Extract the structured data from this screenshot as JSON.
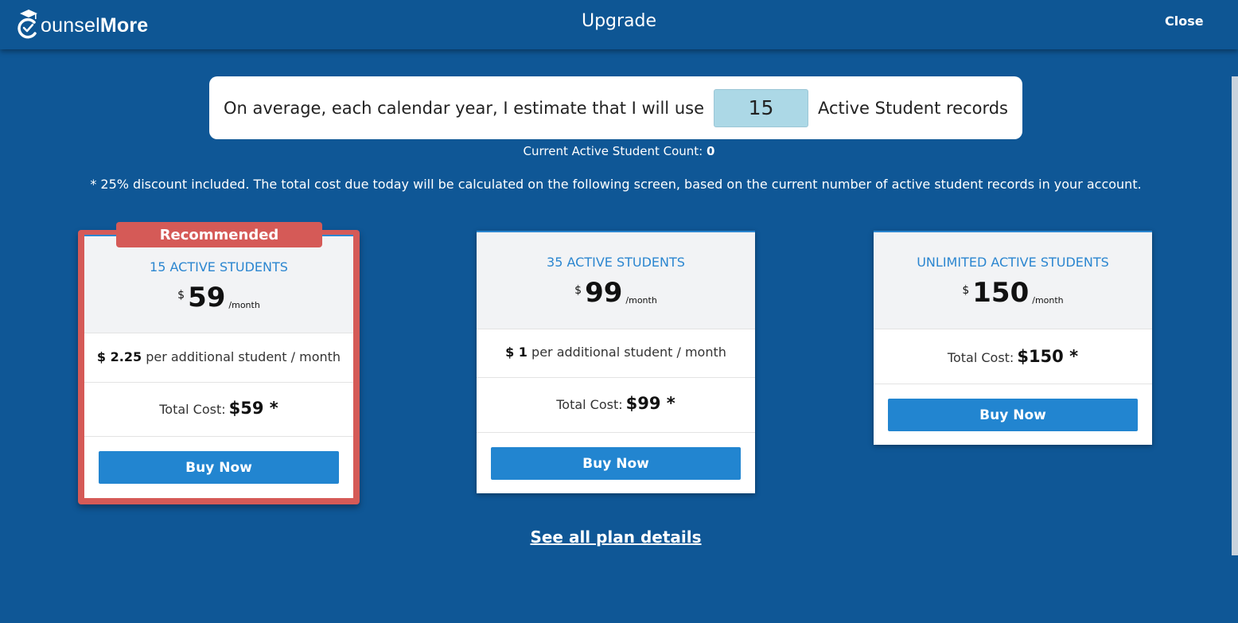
{
  "header": {
    "logo_prefix": "ounsel",
    "logo_bold": "More",
    "title": "Upgrade",
    "close_label": "Close"
  },
  "estimate": {
    "prefix": "On average, each calendar year, I estimate that I will use",
    "value": "15",
    "suffix": "Active Student records"
  },
  "count": {
    "label": "Current Active Student Count:",
    "value": "0"
  },
  "disclaimer": "* 25% discount included. The total cost due today will be calculated on the following screen, based on the current number of active student records in your account.",
  "plans": [
    {
      "badge": "Recommended",
      "name": "15 ACTIVE STUDENTS",
      "currency": "$",
      "price": "59",
      "period": "/month",
      "addl_price": "$ 2.25",
      "addl_text": "per additional student / month",
      "total_label": "Total Cost:",
      "total_value": "$59 *",
      "button": "Buy Now"
    },
    {
      "name": "35 ACTIVE STUDENTS",
      "currency": "$",
      "price": "99",
      "period": "/month",
      "addl_price": "$ 1",
      "addl_text": "per additional student / month",
      "total_label": "Total Cost:",
      "total_value": "$99 *",
      "button": "Buy Now"
    },
    {
      "name": "UNLIMITED ACTIVE STUDENTS",
      "currency": "$",
      "price": "150",
      "period": "/month",
      "total_label": "Total Cost:",
      "total_value": "$150 *",
      "button": "Buy Now"
    }
  ],
  "plan_details_link": "See all plan details",
  "colors": {
    "background": "#0f5796",
    "accent": "#2285d0",
    "recommended": "#d55a57",
    "input_bg": "#acd8e6"
  }
}
